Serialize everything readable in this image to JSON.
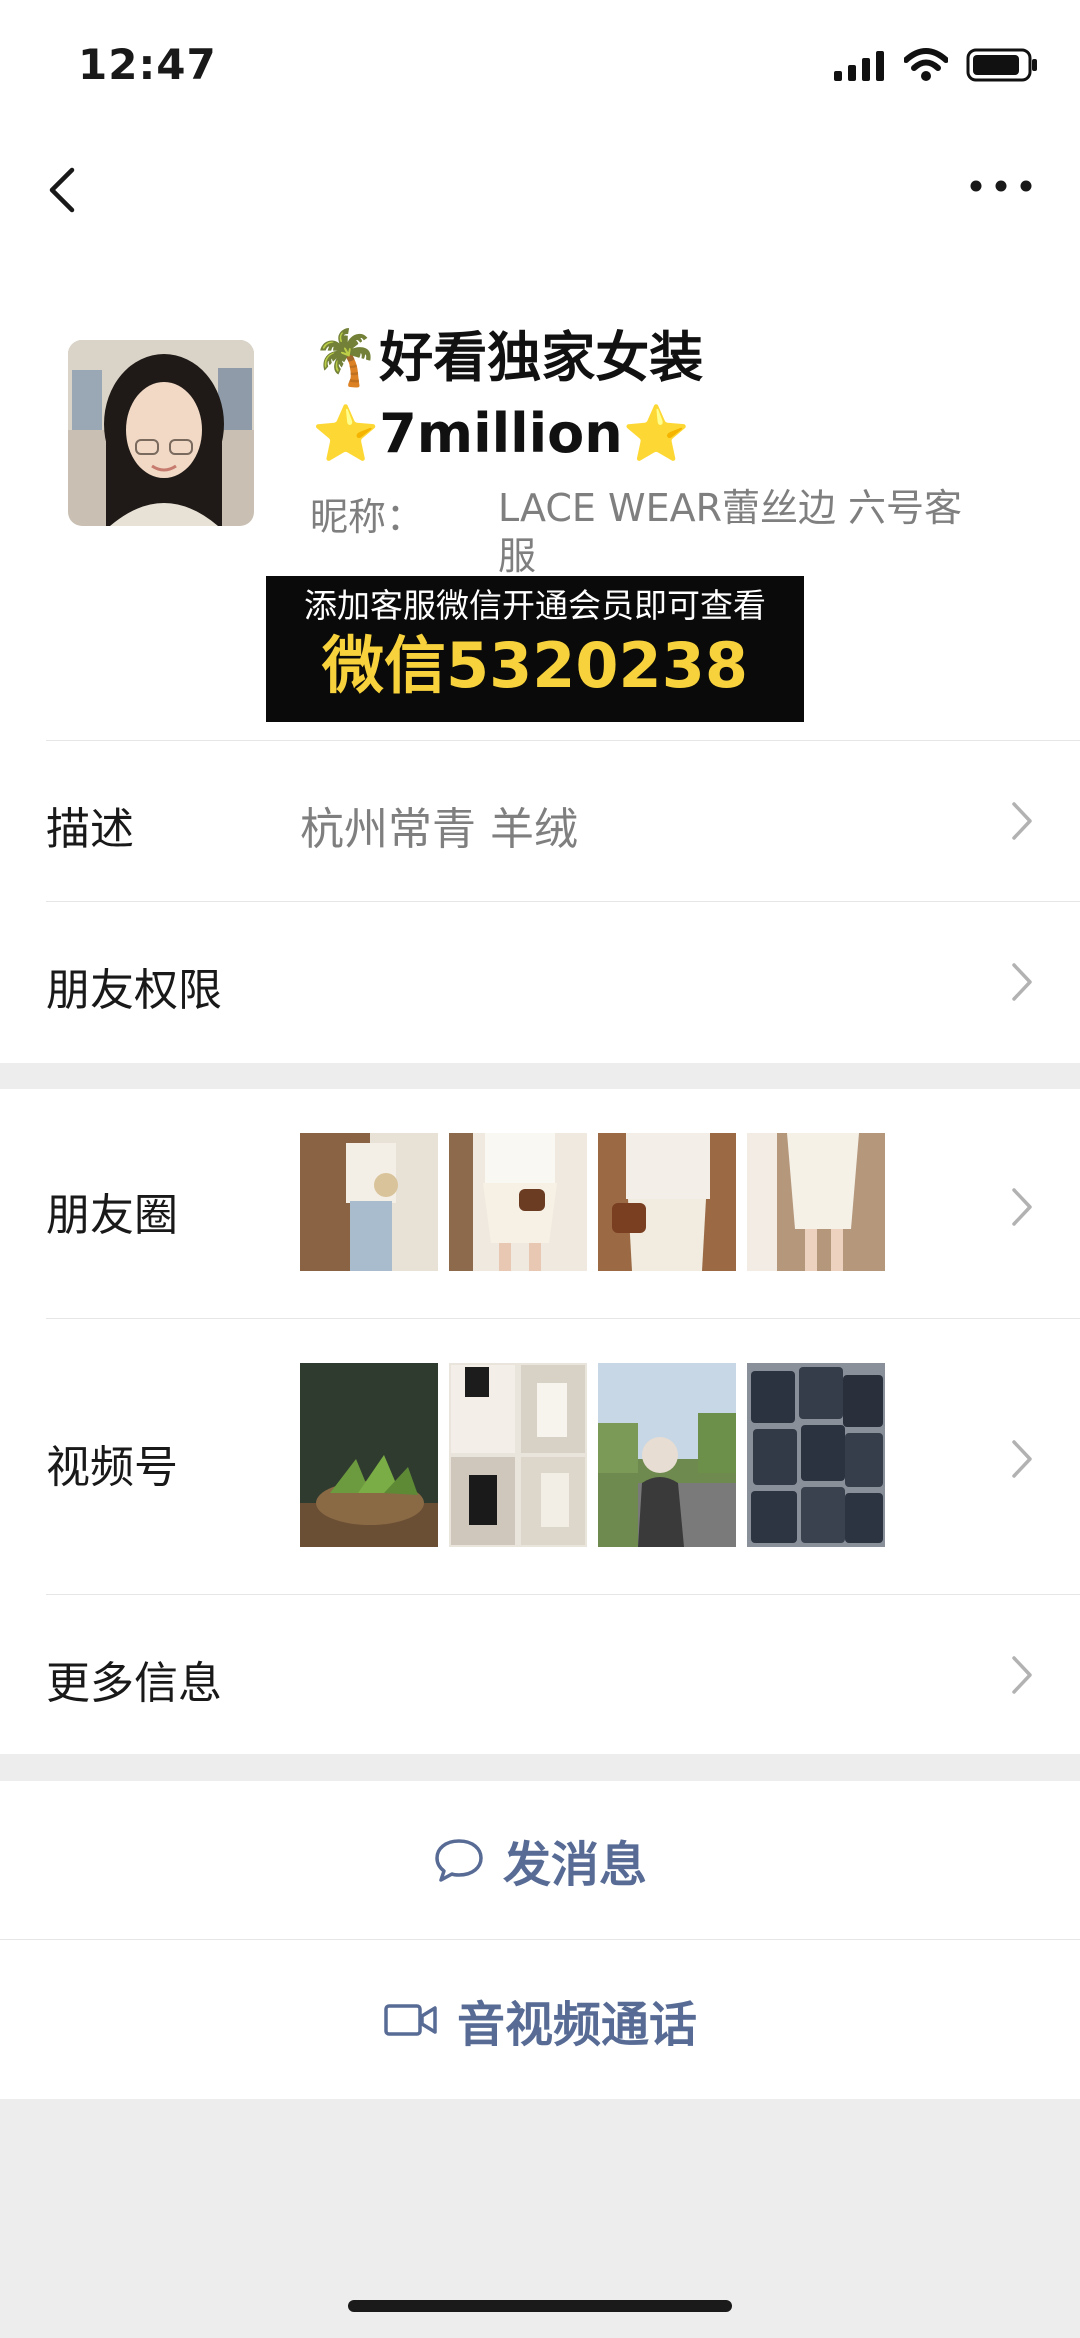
{
  "status_bar": {
    "time": "12:47"
  },
  "profile": {
    "name": "🌴好看独家女装⭐7million⭐",
    "nickname_label": "昵称：",
    "nickname": "LACE WEAR蕾丝边 六号客服"
  },
  "promo": {
    "line1": "添加客服微信开通会员即可查看",
    "line2": "微信5320238"
  },
  "rows": {
    "description": {
      "label": "描述",
      "value": "杭州常青  羊绒"
    },
    "friend_permission": {
      "label": "朋友权限"
    },
    "moments": {
      "label": "朋友圈"
    },
    "channels": {
      "label": "视频号"
    },
    "more_info": {
      "label": "更多信息"
    }
  },
  "actions": {
    "message": "发消息",
    "call": "音视频通话"
  },
  "colors": {
    "link": "#576b95",
    "promo_text": "#f7d23c"
  }
}
